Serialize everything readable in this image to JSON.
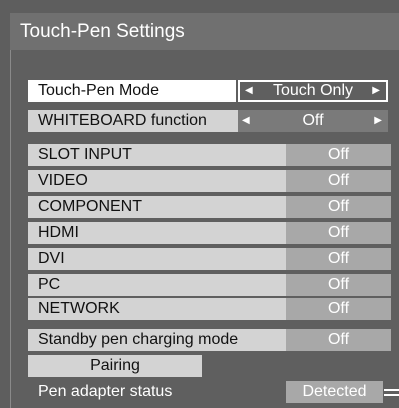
{
  "title": "Touch-Pen Settings",
  "touch_pen_mode": {
    "label": "Touch-Pen Mode",
    "value": "Touch Only"
  },
  "whiteboard": {
    "label": "WHITEBOARD function",
    "value": "Off"
  },
  "inputs": [
    {
      "label": "SLOT INPUT",
      "value": "Off"
    },
    {
      "label": "VIDEO",
      "value": "Off"
    },
    {
      "label": "COMPONENT",
      "value": "Off"
    },
    {
      "label": "HDMI",
      "value": "Off"
    },
    {
      "label": "DVI",
      "value": "Off"
    },
    {
      "label": "PC",
      "value": "Off"
    },
    {
      "label": "NETWORK",
      "value": "Off"
    }
  ],
  "standby": {
    "label": "Standby pen charging mode",
    "value": "Off"
  },
  "pairing": {
    "label": "Pairing"
  },
  "adapter": {
    "label": "Pen adapter status",
    "value": "Detected"
  },
  "arrows": {
    "left": "◀",
    "right": "▶"
  }
}
